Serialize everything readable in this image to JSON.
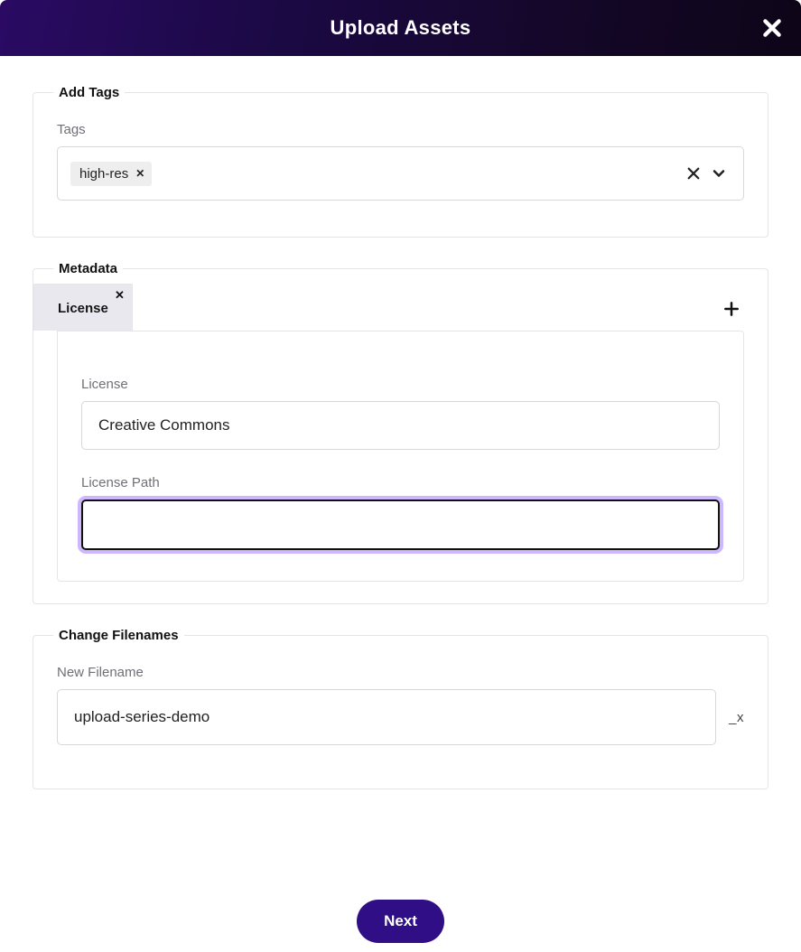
{
  "header": {
    "title": "Upload Assets"
  },
  "tags_section": {
    "legend": "Add Tags",
    "label": "Tags",
    "chips": [
      {
        "text": "high-res"
      }
    ]
  },
  "metadata_section": {
    "legend": "Metadata",
    "tabs": [
      {
        "label": "License"
      }
    ],
    "fields": {
      "license_label": "License",
      "license_value": "Creative Commons",
      "license_path_label": "License Path",
      "license_path_value": ""
    }
  },
  "filenames_section": {
    "legend": "Change Filenames",
    "label": "New Filename",
    "value": "upload-series-demo",
    "suffix": "_x"
  },
  "footer": {
    "next": "Next"
  }
}
